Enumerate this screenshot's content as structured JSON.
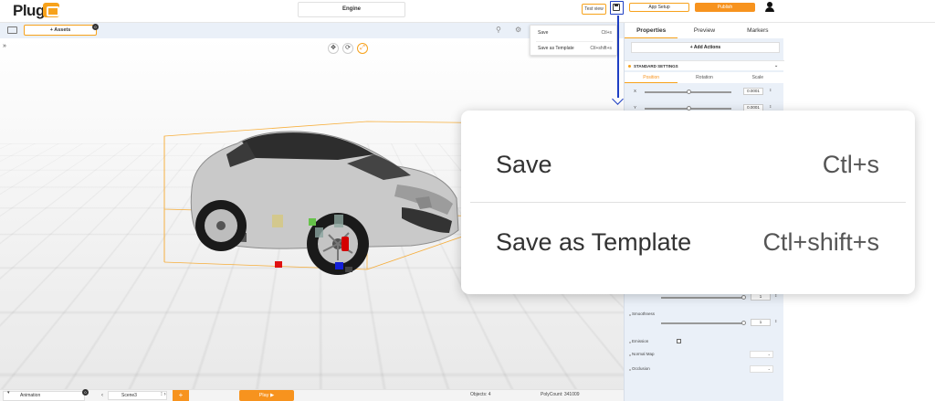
{
  "app": {
    "logo_text": "Plug",
    "project_name": "Engine"
  },
  "toolbar": {
    "test_view_label": "Test view",
    "app_setup_label": "App Setup",
    "publish_label": "Publish"
  },
  "assets": {
    "label": "+ Assets",
    "badge": "0"
  },
  "save_menu": {
    "items": [
      {
        "label": "Save",
        "shortcut": "Ctl+s"
      },
      {
        "label": "Save as Template",
        "shortcut": "Ctl+shift+s"
      }
    ]
  },
  "panel": {
    "tabs": [
      "Properties",
      "Preview",
      "Markers"
    ],
    "add_actions_label": "+ Add Actions",
    "section_title": "STANDARD SETTINGS",
    "sub_tabs": [
      "Position",
      "Rotation",
      "Scale"
    ],
    "position_rows": [
      {
        "axis": "X",
        "value": "0.0001"
      },
      {
        "axis": "Y",
        "value": "0.0001"
      }
    ],
    "material": {
      "upper_value": "1",
      "smoothness_label": "Smoothness",
      "smoothness_value": "1",
      "emission_label": "Emission",
      "normal_map_label": "Normal Map",
      "occlusion_label": "Occlusion"
    }
  },
  "bottom": {
    "animation_label": "Animation",
    "animation_badge": "0",
    "scene_label": "Scene3",
    "add_label": "+",
    "play_label": "Play ▶",
    "objects_label": "Objects: 4",
    "polycount_label": "PolyCount: 341009"
  },
  "colors": {
    "accent": "#f7931e",
    "highlight": "#1e3fc4",
    "panel_bg": "#eaf0f8"
  }
}
